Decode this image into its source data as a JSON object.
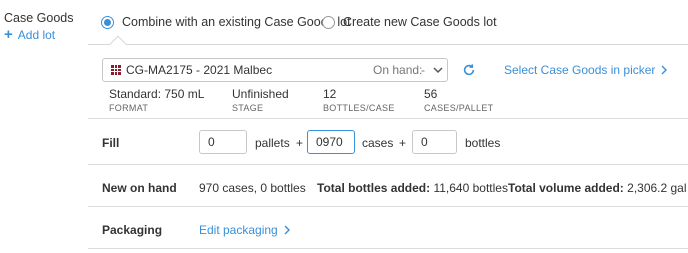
{
  "section": {
    "title": "Case Goods",
    "add_lot_label": "Add lot"
  },
  "options": {
    "combine_label": "Combine with an existing Case Goods lot",
    "create_label": "Create new Case Goods lot",
    "selected": "combine"
  },
  "lot": {
    "name": "CG-MA2175 - 2021 Malbec",
    "on_hand_label": "On hand:",
    "on_hand_value": "-",
    "swatch_color": "#8b1c2c"
  },
  "picker_link": "Select Case Goods in picker",
  "stats": [
    {
      "value": "Standard: 750 mL",
      "label": "FORMAT"
    },
    {
      "value": "Unfinished",
      "label": "STAGE"
    },
    {
      "value": "12",
      "label": "BOTTLES/CASE"
    },
    {
      "value": "56",
      "label": "CASES/PALLET"
    }
  ],
  "fill": {
    "label": "Fill",
    "pallets_value": "0",
    "pallets_unit": "pallets",
    "plus1": "+",
    "cases_value": "0970",
    "cases_unit": "cases",
    "plus2": "+",
    "bottles_value": "0",
    "bottles_unit": "bottles"
  },
  "new_on_hand": {
    "label": "New on hand",
    "value": "970 cases, 0 bottles",
    "total_bottles_label": "Total bottles added:",
    "total_bottles_value": "11,640 bottles",
    "total_volume_label": "Total volume added:",
    "total_volume_value": "2,306.2 gal"
  },
  "packaging": {
    "label": "Packaging",
    "edit_label": "Edit packaging"
  },
  "colors": {
    "accent": "#3a8fd9",
    "border": "#d8d8d8"
  }
}
